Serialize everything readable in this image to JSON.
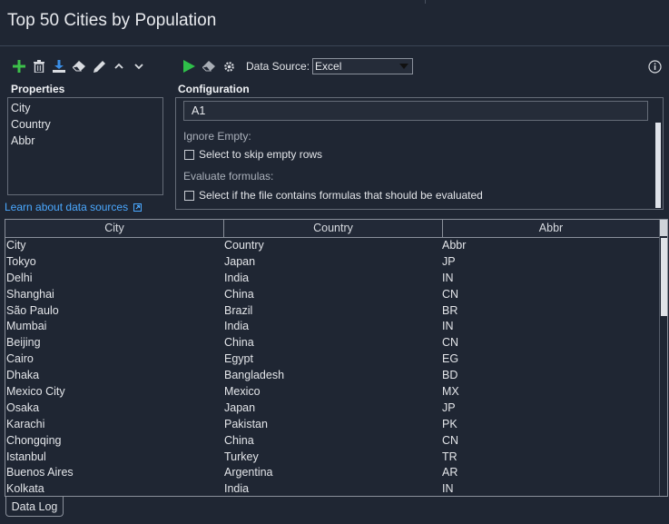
{
  "window": {
    "title": "Top 50 Cities by Population"
  },
  "toolbar": {
    "icons": [
      "add-icon",
      "delete-icon",
      "download-icon",
      "eraser-icon",
      "pencil-icon",
      "chevron-up-icon",
      "chevron-down-icon"
    ],
    "run_icons": [
      "play-icon",
      "clear-icon",
      "gear-icon"
    ],
    "data_source_label": "Data Source:",
    "data_source_value": "Excel"
  },
  "properties": {
    "label": "Properties",
    "items": [
      "City",
      "Country",
      "Abbr"
    ],
    "learn_link": "Learn about data sources"
  },
  "configuration": {
    "label": "Configuration",
    "range_value": "A1",
    "ignore_empty_label": "Ignore Empty:",
    "skip_empty_text": "Select to skip empty rows",
    "evaluate_label": "Evaluate formulas:",
    "evaluate_text": "Select if the file contains formulas that should be evaluated"
  },
  "grid": {
    "columns": [
      "City",
      "Country",
      "Abbr"
    ],
    "rows": [
      [
        "City",
        "Country",
        "Abbr"
      ],
      [
        "Tokyo",
        "Japan",
        "JP"
      ],
      [
        "Delhi",
        "India",
        "IN"
      ],
      [
        "Shanghai",
        "China",
        "CN"
      ],
      [
        "São Paulo",
        "Brazil",
        "BR"
      ],
      [
        "Mumbai",
        "India",
        "IN"
      ],
      [
        "Beijing",
        "China",
        "CN"
      ],
      [
        "Cairo",
        "Egypt",
        "EG"
      ],
      [
        "Dhaka",
        "Bangladesh",
        "BD"
      ],
      [
        "Mexico City",
        "Mexico",
        "MX"
      ],
      [
        "Osaka",
        "Japan",
        "JP"
      ],
      [
        "Karachi",
        "Pakistan",
        "PK"
      ],
      [
        "Chongqing",
        "China",
        "CN"
      ],
      [
        "Istanbul",
        "Turkey",
        "TR"
      ],
      [
        "Buenos Aires",
        "Argentina",
        "AR"
      ],
      [
        "Kolkata",
        "India",
        "IN"
      ]
    ]
  },
  "tabs": {
    "data_log": "Data Log"
  },
  "colors": {
    "background": "#1f2633",
    "add": "#3cc04a",
    "play": "#2fbf4a",
    "link": "#4aa8ff",
    "download": "#3a8ee6"
  }
}
